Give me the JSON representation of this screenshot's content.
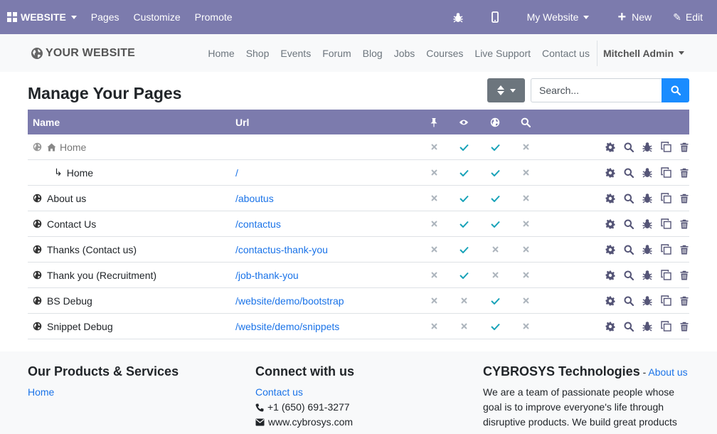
{
  "topbar": {
    "app_label": "WEBSITE",
    "menu": [
      "Pages",
      "Customize",
      "Promote"
    ],
    "website_label": "My Website",
    "new_label": "New",
    "edit_label": "Edit"
  },
  "site": {
    "brand": "YOUR WEBSITE",
    "nav": [
      "Home",
      "Shop",
      "Events",
      "Forum",
      "Blog",
      "Jobs",
      "Courses",
      "Live Support",
      "Contact us"
    ],
    "user": "Mitchell Admin"
  },
  "page": {
    "title": "Manage Your Pages",
    "search_placeholder": "Search..."
  },
  "table": {
    "headers": {
      "name": "Name",
      "url": "Url"
    },
    "header_icons": [
      "pin-icon",
      "eye-icon",
      "globe-icon",
      "search-icon"
    ],
    "rows": [
      {
        "name": "Home",
        "url": "",
        "type": "home",
        "pinned": false,
        "visible": true,
        "published": true,
        "indexed": false
      },
      {
        "name": "Home",
        "url": "/",
        "type": "child",
        "pinned": false,
        "visible": true,
        "published": true,
        "indexed": false
      },
      {
        "name": "About us",
        "url": "/aboutus",
        "type": "page",
        "pinned": false,
        "visible": true,
        "published": true,
        "indexed": false
      },
      {
        "name": "Contact Us",
        "url": "/contactus",
        "type": "page",
        "pinned": false,
        "visible": true,
        "published": true,
        "indexed": false
      },
      {
        "name": "Thanks (Contact us)",
        "url": "/contactus-thank-you",
        "type": "page",
        "pinned": false,
        "visible": true,
        "published": false,
        "indexed": false
      },
      {
        "name": "Thank you (Recruitment)",
        "url": "/job-thank-you",
        "type": "page",
        "pinned": false,
        "visible": true,
        "published": false,
        "indexed": false
      },
      {
        "name": "BS Debug",
        "url": "/website/demo/bootstrap",
        "type": "page",
        "pinned": false,
        "visible": false,
        "published": true,
        "indexed": false
      },
      {
        "name": "Snippet Debug",
        "url": "/website/demo/snippets",
        "type": "page",
        "pinned": false,
        "visible": false,
        "published": true,
        "indexed": false
      }
    ],
    "row_actions": [
      "gear-icon",
      "search-icon",
      "bug-icon",
      "clone-icon",
      "trash-icon"
    ]
  },
  "footer": {
    "col1": {
      "title": "Our Products & Services",
      "links": [
        "Home"
      ]
    },
    "col2": {
      "title": "Connect with us",
      "link": "Contact us",
      "phone": "+1 (650) 691-3277",
      "email": "www.cybrosys.com"
    },
    "col3": {
      "title": "CYBROSYS Technologies",
      "dash": " - ",
      "link": "About us",
      "text": "We are a team of passionate people whose goal is to improve everyone's life through disruptive products. We build great products"
    }
  },
  "colors": {
    "topbar": "#7c7bad",
    "link": "#1a73e8",
    "check": "#17a2b8",
    "cross": "#adb5bd",
    "icon": "#555577",
    "search_btn": "#1a8cff"
  }
}
